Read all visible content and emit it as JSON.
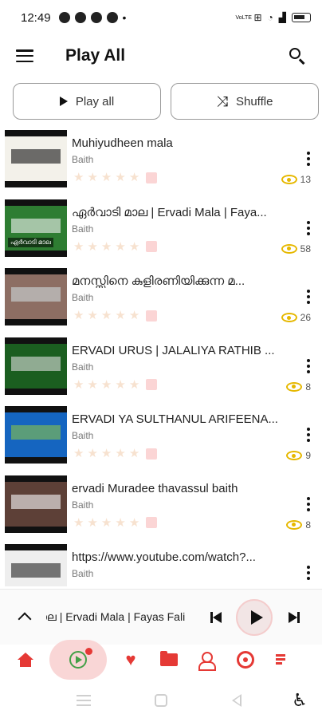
{
  "status_bar": {
    "time": "12:49",
    "network_label": "VoLTE",
    "dot": "•",
    "icons": [
      "whatsapp-icon",
      "app-icon",
      "app-icon",
      "app-icon",
      "vibrate-icon",
      "wifi-icon",
      "signal-icon",
      "battery-charging-icon"
    ]
  },
  "header": {
    "title": "Play All",
    "menu_icon": "hamburger-menu-icon",
    "search_icon": "search-icon"
  },
  "actions": {
    "play_all_label": "Play all",
    "shuffle_label": "Shuffle"
  },
  "tracks": [
    {
      "title": "Muhiyudheen mala",
      "subtitle": "Baith",
      "views": "13",
      "thumb_bg": "#f3f1ea",
      "thumb_accent": "#111111",
      "thumb_caption": ""
    },
    {
      "title": "ഏർവാടി മാല | Ervadi Mala | Faya...",
      "subtitle": "Baith",
      "views": "58",
      "thumb_bg": "#2e7d32",
      "thumb_accent": "#f5f5f5",
      "thumb_caption": "ഏർവാടി മാല"
    },
    {
      "title": "മനസ്സിനെ കുളിരണിയിക്കുന്ന മ...",
      "subtitle": "Baith",
      "views": "26",
      "thumb_bg": "#8d6e63",
      "thumb_accent": "#cfd8dc",
      "thumb_caption": ""
    },
    {
      "title": "ERVADI URUS | JALALIYA RATHIB ...",
      "subtitle": "Baith",
      "views": "8",
      "thumb_bg": "#1b5e20",
      "thumb_accent": "#e0e0e0",
      "thumb_caption": ""
    },
    {
      "title": "ERVADI YA SULTHANUL ARIFEENA...",
      "subtitle": "Baith",
      "views": "9",
      "thumb_bg": "#1565c0",
      "thumb_accent": "#8bc34a",
      "thumb_caption": ""
    },
    {
      "title": "ervadi Muradee thavassul baith",
      "subtitle": "Baith",
      "views": "8",
      "thumb_bg": "#5d4037",
      "thumb_accent": "#fafafa",
      "thumb_caption": ""
    },
    {
      "title": "https://www.youtube.com/watch?...",
      "subtitle": "Baith",
      "views": "",
      "thumb_bg": "#eeeeee",
      "thumb_accent": "#212121",
      "thumb_caption": ""
    }
  ],
  "mini_player": {
    "now_playing": "ഏർവാടി മാല | Ervadi Mala | Fayas Fali"
  },
  "bottom_nav": {
    "items": [
      "home-icon",
      "now-playing-icon",
      "favorites-icon",
      "folder-icon",
      "artists-icon",
      "albums-icon",
      "queue-icon"
    ],
    "accent": "#e53935",
    "active_bg": "#f9d6d6",
    "now_playing_color": "#43a047"
  },
  "system_nav": {
    "items": [
      "recent-apps-icon",
      "home-square-icon",
      "back-icon",
      "accessibility-icon"
    ]
  },
  "colors": {
    "eye": "#e6b800",
    "star_placeholder": "#f7e2d0",
    "badge": "#fbd5d5"
  }
}
